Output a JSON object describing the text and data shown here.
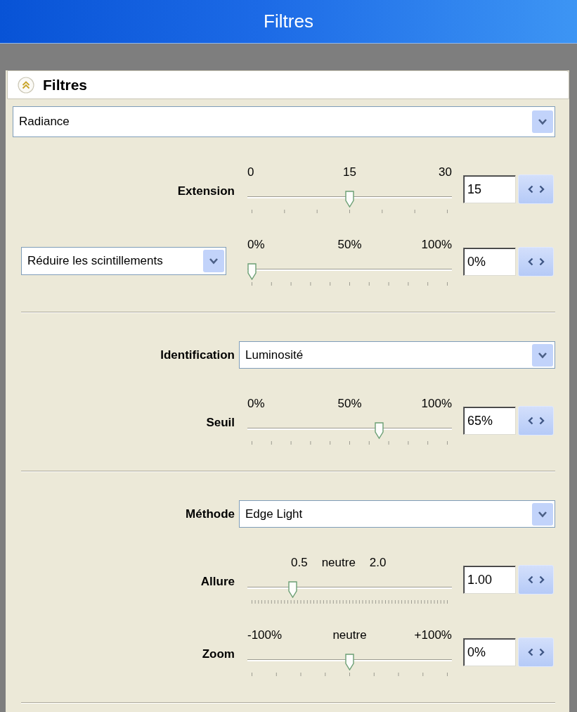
{
  "window": {
    "title": "Filtres"
  },
  "panel": {
    "title": "Filtres",
    "expanded": true,
    "sections": [
      {
        "rows": [
          {
            "kind": "dropdown",
            "value": "Radiance"
          },
          {
            "kind": "slider",
            "label": "Extension",
            "scale": [
              "0",
              "15",
              "30"
            ],
            "compact_scale": false,
            "level": 0.5,
            "value": "15"
          },
          {
            "kind": "slider",
            "selector": "Réduire les scintillements",
            "scale": [
              "0%",
              "50%",
              "100%"
            ],
            "compact_scale": false,
            "level": 0,
            "value": "0%"
          }
        ]
      },
      {
        "rows": [
          {
            "kind": "dropdown",
            "label": "Identification",
            "value": "Luminosité"
          },
          {
            "kind": "slider",
            "label": "Seuil",
            "scale": [
              "0%",
              "50%",
              "100%"
            ],
            "compact_scale": false,
            "level": 0.65,
            "value": "65%"
          }
        ]
      },
      {
        "rows": [
          {
            "kind": "dropdown",
            "label": "Méthode",
            "value": "Edge Light"
          },
          {
            "kind": "slider",
            "label": "Allure",
            "scale": [
              "0.5",
              "neutre",
              "2.0"
            ],
            "compact_scale": true,
            "level": 0.21,
            "value": "1.00"
          },
          {
            "kind": "slider",
            "label": "Zoom",
            "scale": [
              "-100%",
              "neutre",
              "+100%"
            ],
            "compact_scale": false,
            "level": 0.5,
            "value": "0%"
          }
        ]
      }
    ]
  }
}
